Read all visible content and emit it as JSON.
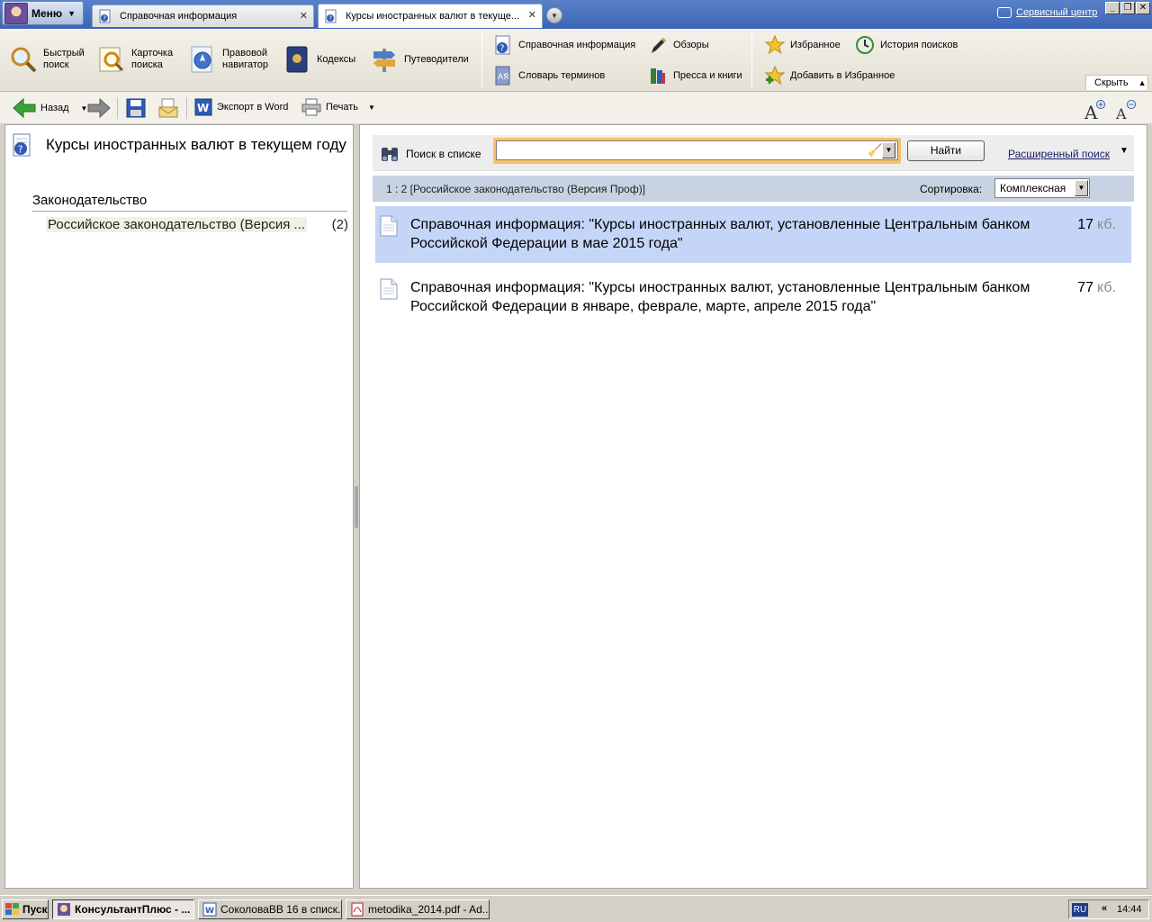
{
  "titlebar": {
    "menu_label": "Меню",
    "tabs": [
      {
        "label": "Справочная информация",
        "active": false
      },
      {
        "label": "Курсы иностранных валют в текуще...",
        "active": true
      }
    ],
    "service_center": "Сервисный центр",
    "window_controls": [
      "_",
      "❐",
      "✕"
    ]
  },
  "ribbon": {
    "big_items": [
      {
        "label_1": "Быстрый",
        "label_2": "поиск",
        "icon": "magnifier-icon"
      },
      {
        "label_1": "Карточка",
        "label_2": "поиска",
        "icon": "search-card-icon"
      },
      {
        "label_1": "Правовой",
        "label_2": "навигатор",
        "icon": "compass-icon"
      },
      {
        "label_1": "Кодексы",
        "label_2": "",
        "icon": "codex-book-icon"
      },
      {
        "label_1": "Путеводители",
        "label_2": "",
        "icon": "signpost-icon"
      }
    ],
    "small_items": {
      "reference": "Справочная информация",
      "dictionary": "Словарь терминов",
      "reviews": "Обзоры",
      "press": "Пресса и книги",
      "favorites": "Избранное",
      "history": "История поисков",
      "add_favorites": "Добавить в Избранное"
    },
    "hide_label": "Скрыть"
  },
  "toolbar": {
    "back_label": "Назад",
    "export_label": "Экспорт в Word",
    "print_label": "Печать"
  },
  "left": {
    "doc_title": "Курсы иностранных валют в текущем году",
    "section": "Законодательство",
    "row_label": "Российское законодательство (Версия ...",
    "row_count": "(2)"
  },
  "search": {
    "label": "Поиск в списке",
    "value": "",
    "find_label": "Найти",
    "advanced": "Расширенный поиск"
  },
  "list": {
    "count_text": "1 : 2 [Российское законодательство (Версия Проф)]",
    "sort_label": "Сортировка:",
    "sort_value": "Комплексная",
    "results": [
      {
        "title": "Справочная информация: \"Курсы иностранных валют, установленные Центральным банком Российской Федерации в мае 2015 года\"",
        "size": "17",
        "unit": "кб.",
        "selected": true
      },
      {
        "title": "Справочная информация: \"Курсы иностранных валют, установленные Центральным банком Российской Федерации в январе, феврале, марте, апреле 2015 года\"",
        "size": "77",
        "unit": "кб.",
        "selected": false
      }
    ]
  },
  "taskbar": {
    "start": "Пуск",
    "tasks": [
      {
        "label": "КонсультантПлюс - ...",
        "active": true
      },
      {
        "label": "СоколоваВВ 16 в списк...",
        "active": false
      },
      {
        "label": "metodika_2014.pdf - Ad...",
        "active": false
      }
    ],
    "lang": "RU",
    "tray_arrows": "«",
    "clock": "14:44"
  },
  "colors": {
    "titlebar": "#3b64b6",
    "selection": "#c5d5f7",
    "search_highlight": "#f6c26a",
    "list_header": "#c7d3e2"
  }
}
